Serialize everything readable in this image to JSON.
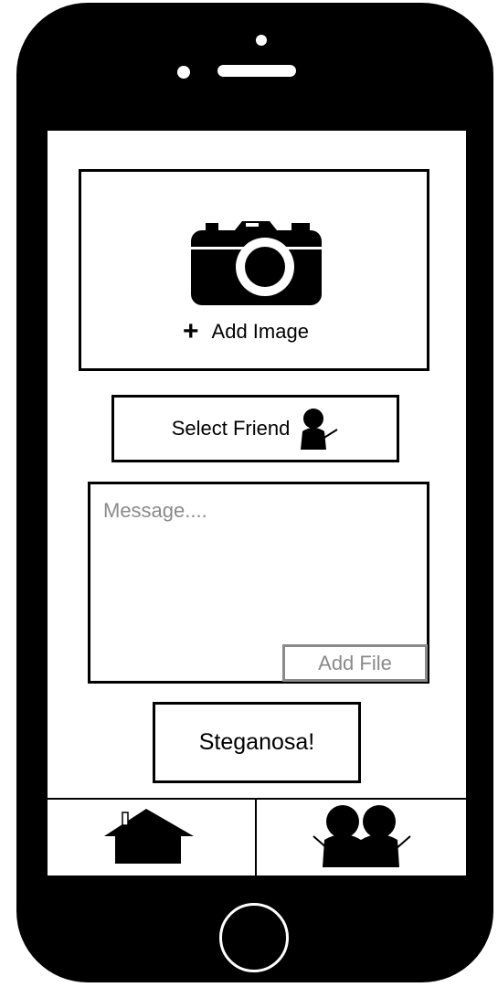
{
  "compose": {
    "add_image_label": "Add Image",
    "plus_glyph": "+",
    "select_friend_label": "Select Friend",
    "message_placeholder": "Message....",
    "message_value": "",
    "add_file_label": "Add File",
    "submit_label": "Steganosa!"
  },
  "icons": {
    "camera": "camera-icon",
    "add": "plus-icon",
    "friend": "person-icon",
    "home": "home-icon",
    "friends": "friends-icon"
  },
  "colors": {
    "device": "#000000",
    "screen": "#ffffff",
    "border": "#000000",
    "muted": "#8a8a8a"
  }
}
